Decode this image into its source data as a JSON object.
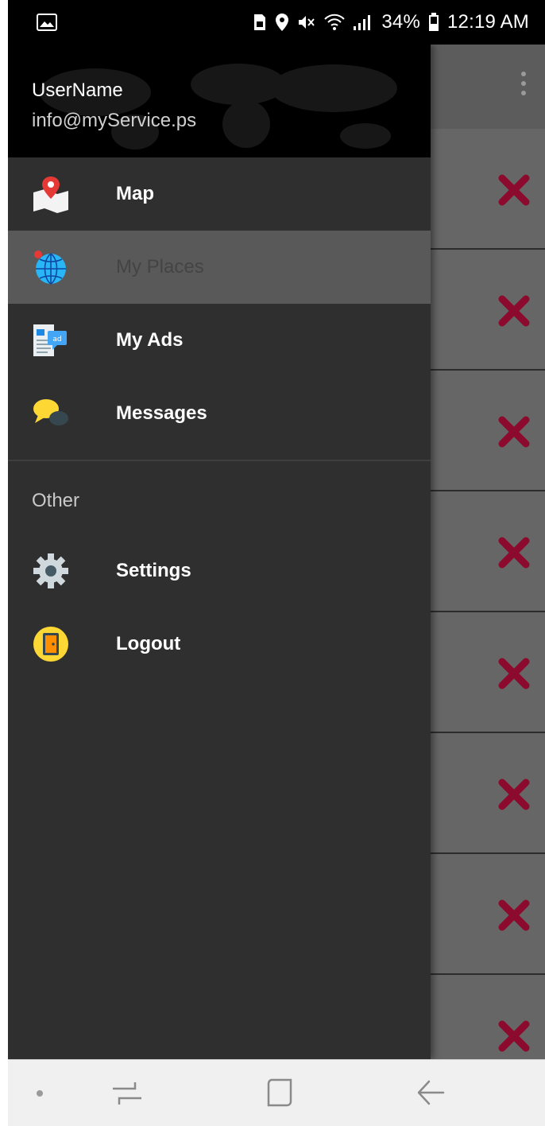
{
  "status_bar": {
    "battery_percent": "34%",
    "time": "12:19 AM"
  },
  "drawer": {
    "header": {
      "user_name": "UserName",
      "user_email": "info@myService.ps"
    },
    "main_items": [
      {
        "label": "Map",
        "icon": "map-pin-icon"
      },
      {
        "label": "My Places",
        "icon": "globe-icon"
      },
      {
        "label": "My Ads",
        "icon": "ads-icon"
      },
      {
        "label": "Messages",
        "icon": "chat-bubble-icon"
      }
    ],
    "selected_item": "My Places",
    "other_section": {
      "title": "Other",
      "items": [
        {
          "label": "Settings",
          "icon": "gear-icon"
        },
        {
          "label": "Logout",
          "icon": "logout-icon"
        }
      ]
    }
  },
  "background_list": {
    "row_action_icon": "close-icon",
    "accent_color": "#8b0a2e"
  },
  "nav_bar": {
    "buttons": [
      "recents",
      "home",
      "back"
    ]
  }
}
